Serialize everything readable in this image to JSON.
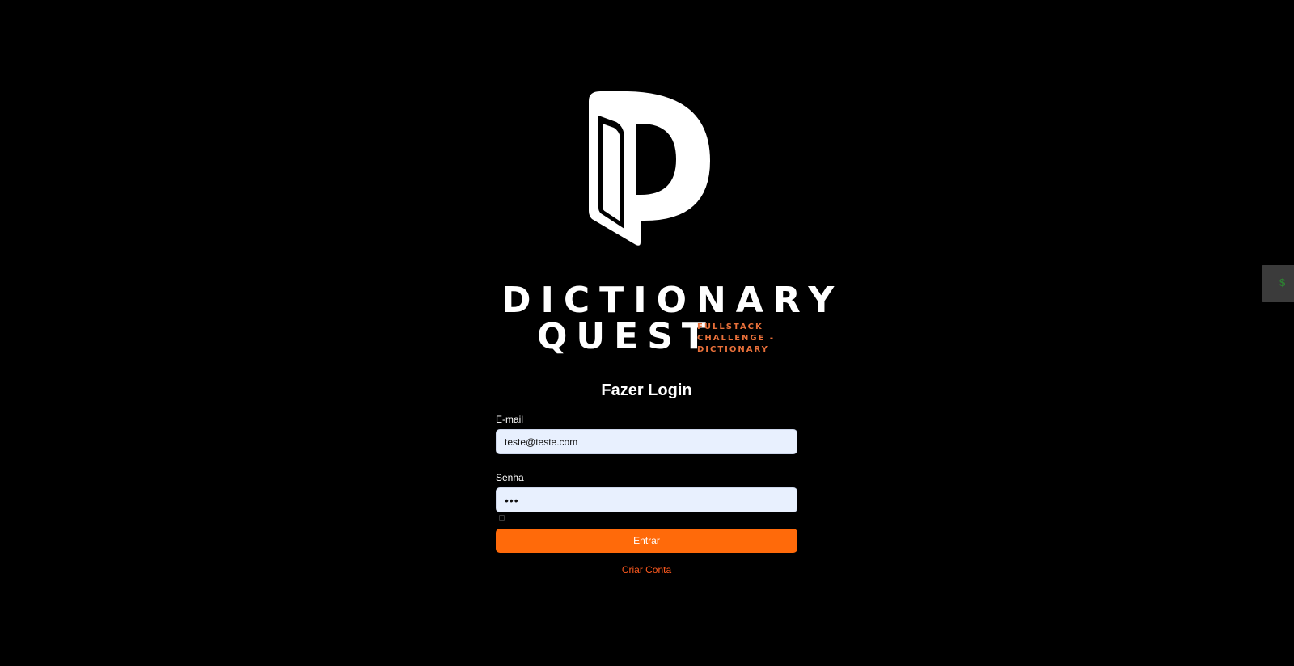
{
  "logo": {
    "title_line1": "DICTIONARY",
    "title_line2": "QUEST",
    "tagline": [
      "FULLSTACK",
      "CHALLENGE -",
      "DICTIONARY"
    ],
    "colors": {
      "main": "#ffffff",
      "tagline": "#e8703a"
    }
  },
  "login": {
    "heading": "Fazer Login",
    "email_label": "E-mail",
    "email_value": "teste@teste.com",
    "password_label": "Senha",
    "password_value": "•••",
    "submit_label": "Entrar",
    "create_account_label": "Criar Conta"
  },
  "side_tab": {
    "glyph": "$",
    "icon": "dollar-icon"
  },
  "colors": {
    "background": "#000000",
    "accent": "#ff6a0a",
    "link": "#ff5a1f",
    "input_bg": "#e8f0fe"
  }
}
